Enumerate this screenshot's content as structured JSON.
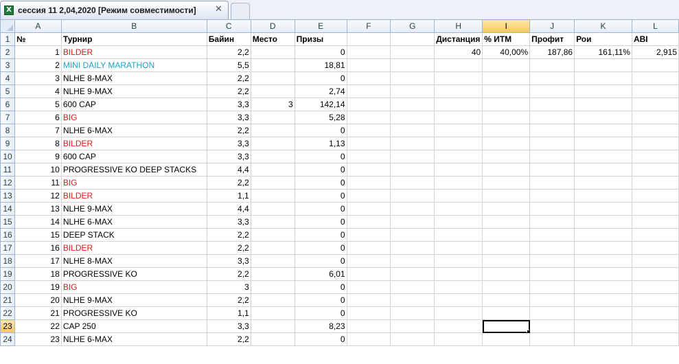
{
  "window": {
    "tab_title": "сессия 11 2,04,2020  [Режим совместимости]",
    "close_glyph": "✕",
    "file_icon_glyph": "X"
  },
  "columns": [
    "A",
    "B",
    "C",
    "D",
    "E",
    "F",
    "G",
    "H",
    "I",
    "J",
    "K",
    "L"
  ],
  "active_column": "I",
  "active_row": 23,
  "colors": {
    "red": "#e01b1b",
    "cyan": "#1aa3c9",
    "header_active": "#f7c65a"
  },
  "rows": [
    {
      "n": 1,
      "A": "№",
      "B": "Турнир",
      "C": "Байин",
      "D": "Место",
      "E": "Призы",
      "H": "Дистанция",
      "I": "% ИТМ",
      "J": "Профит",
      "K": "Рои",
      "L": "ABI"
    },
    {
      "n": 2,
      "A": "1",
      "B": "BILDER",
      "b_color": "red",
      "C": "2,2",
      "D": "",
      "E": "0",
      "H": "40",
      "I": "40,00%",
      "J": "187,86",
      "K": "161,11%",
      "L": "2,915"
    },
    {
      "n": 3,
      "A": "2",
      "B": "MINI DAILY MARATHON",
      "b_color": "cyan",
      "C": "5,5",
      "D": "",
      "E": "18,81"
    },
    {
      "n": 4,
      "A": "3",
      "B": "NLHE 8-MAX",
      "C": "2,2",
      "D": "",
      "E": "0"
    },
    {
      "n": 5,
      "A": "4",
      "B": "NLHE 9-MAX",
      "C": "2,2",
      "D": "",
      "E": "2,74"
    },
    {
      "n": 6,
      "A": "5",
      "B": "600 CAP",
      "C": "3,3",
      "D": "3",
      "E": "142,14"
    },
    {
      "n": 7,
      "A": "6",
      "B": "BIG",
      "b_color": "red",
      "C": "3,3",
      "D": "",
      "E": "5,28"
    },
    {
      "n": 8,
      "A": "7",
      "B": "NLHE 6-MAX",
      "C": "2,2",
      "D": "",
      "E": "0"
    },
    {
      "n": 9,
      "A": "8",
      "B": "BILDER",
      "b_color": "red",
      "C": "3,3",
      "D": "",
      "E": "1,13"
    },
    {
      "n": 10,
      "A": "9",
      "B": "600 CAP",
      "C": "3,3",
      "D": "",
      "E": "0"
    },
    {
      "n": 11,
      "A": "10",
      "B": "PROGRESSIVE KO DEEP STACKS",
      "C": "4,4",
      "D": "",
      "E": "0"
    },
    {
      "n": 12,
      "A": "11",
      "B": "BIG",
      "b_color": "red",
      "C": "2,2",
      "D": "",
      "E": "0"
    },
    {
      "n": 13,
      "A": "12",
      "B": "BILDER",
      "b_color": "red",
      "C": "1,1",
      "D": "",
      "E": "0"
    },
    {
      "n": 14,
      "A": "13",
      "B": "NLHE 9-MAX",
      "C": "4,4",
      "D": "",
      "E": "0"
    },
    {
      "n": 15,
      "A": "14",
      "B": "NLHE 6-MAX",
      "C": "3,3",
      "D": "",
      "E": "0"
    },
    {
      "n": 16,
      "A": "15",
      "B": "DEEP STACK",
      "C": "2,2",
      "D": "",
      "E": "0"
    },
    {
      "n": 17,
      "A": "16",
      "B": "BILDER",
      "b_color": "red",
      "C": "2,2",
      "D": "",
      "E": "0"
    },
    {
      "n": 18,
      "A": "17",
      "B": "NLHE 8-MAX",
      "C": "3,3",
      "D": "",
      "E": "0"
    },
    {
      "n": 19,
      "A": "18",
      "B": "PROGRESSIVE KO",
      "C": "2,2",
      "D": "",
      "E": "6,01"
    },
    {
      "n": 20,
      "A": "19",
      "B": "BIG",
      "b_color": "red",
      "C": "3",
      "D": "",
      "E": "0"
    },
    {
      "n": 21,
      "A": "20",
      "B": "NLHE 9-MAX",
      "C": "2,2",
      "D": "",
      "E": "0"
    },
    {
      "n": 22,
      "A": "21",
      "B": "PROGRESSIVE KO",
      "C": "1,1",
      "D": "",
      "E": "0"
    },
    {
      "n": 23,
      "A": "22",
      "B": "CAP 250",
      "C": "3,3",
      "D": "",
      "E": "8,23"
    },
    {
      "n": 24,
      "A": "23",
      "B": "NLHE 6-MAX",
      "C": "2,2",
      "D": "",
      "E": "0"
    }
  ]
}
